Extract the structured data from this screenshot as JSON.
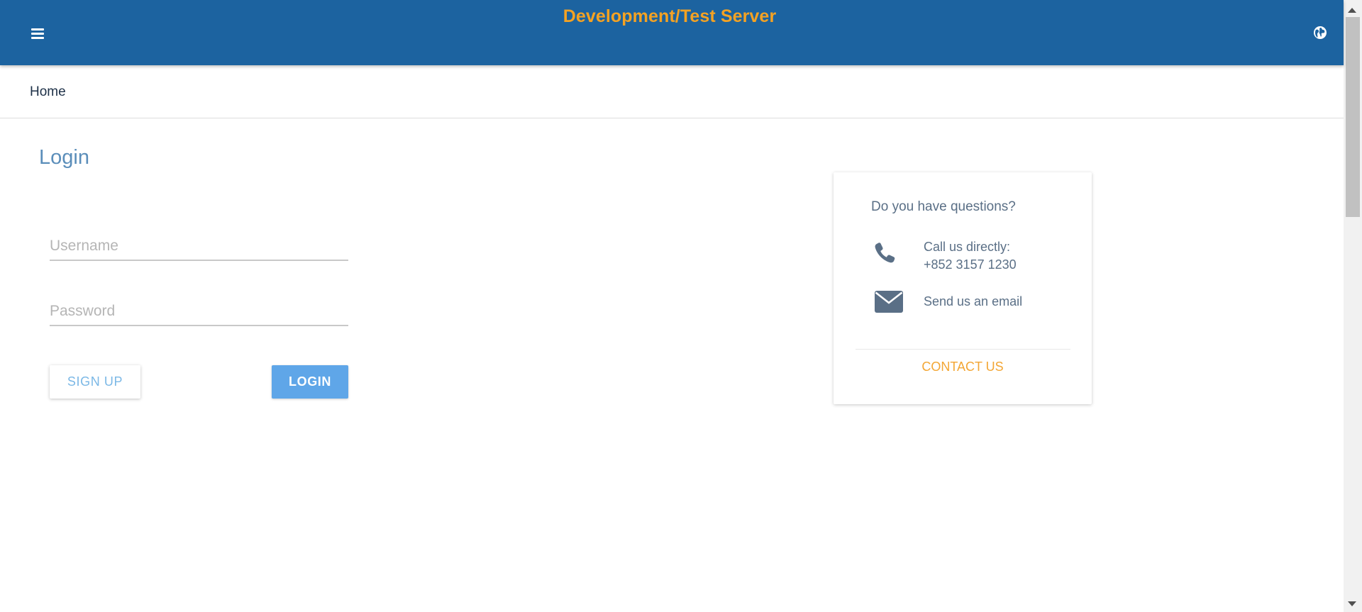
{
  "header": {
    "title": "Development/Test Server",
    "menu_icon": "hamburger-menu-icon",
    "language_icon": "globe-icon",
    "title_color": "#f4a223",
    "background_color": "#1c63a0"
  },
  "breadcrumb": {
    "home_label": "Home"
  },
  "login": {
    "title": "Login",
    "username_placeholder": "Username",
    "username_value": "",
    "password_placeholder": "Password",
    "password_value": "",
    "signup_label": "SIGN UP",
    "login_label": "LOGIN"
  },
  "contact": {
    "question": "Do you have questions?",
    "phone_icon": "phone-icon",
    "call_label": "Call us directly:",
    "phone_number": "+852 3157 1230",
    "email_icon": "envelope-icon",
    "email_label": "Send us an email",
    "contact_us_label": "CONTACT US",
    "accent_color": "#f3a634"
  }
}
